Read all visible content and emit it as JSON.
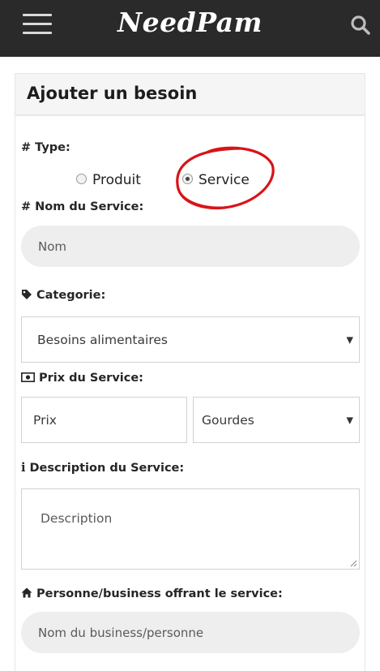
{
  "app": {
    "title": "NeedPam"
  },
  "header": {
    "menu_icon": "hamburger-menu-icon",
    "search_icon": "search-icon"
  },
  "form": {
    "title": "Ajouter un besoin",
    "type_label": "Type:",
    "type_options": [
      "Produit",
      "Service"
    ],
    "type_selected": "Service",
    "name_label": "Nom du Service:",
    "name_placeholder": "Nom",
    "category_label": "Categorie:",
    "category_value": "Besoins alimentaires",
    "price_label": "Prix du Service:",
    "price_placeholder": "Prix",
    "currency_value": "Gourdes",
    "description_label": "Description du Service:",
    "description_placeholder": "Description",
    "provider_label": "Personne/business offrant le service:",
    "provider_placeholder": "Nom du business/personne"
  },
  "annotation": {
    "color": "#d81418",
    "shape": "hand-drawn red circle around Service option"
  },
  "colors": {
    "topbar": "#2a2a2a",
    "input_fill": "#eeeeee",
    "annotation": "#d81418"
  }
}
